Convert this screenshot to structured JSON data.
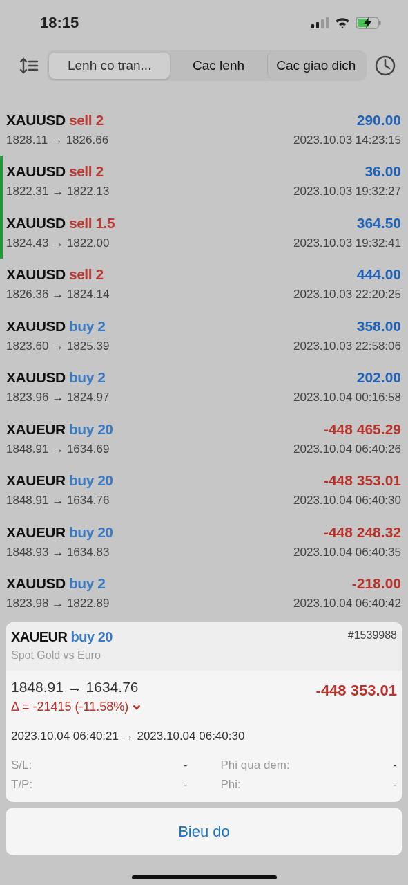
{
  "status_bar": {
    "time": "18:15"
  },
  "tabs": [
    {
      "label": "Lenh co tran...",
      "selected": true
    },
    {
      "label": "Cac lenh",
      "selected": false
    },
    {
      "label": "Cac giao dich",
      "selected": false
    }
  ],
  "trades": [
    {
      "symbol": "XAUUSD",
      "order": "sell 2",
      "kind": "sell",
      "prices": "1828.11 → 1826.66",
      "profit": "290.00",
      "loss": false,
      "time": "2023.10.03 14:23:15",
      "highlighted": false
    },
    {
      "symbol": "XAUUSD",
      "order": "sell 2",
      "kind": "sell",
      "prices": "1822.31 → 1822.13",
      "profit": "36.00",
      "loss": false,
      "time": "2023.10.03 19:32:27",
      "highlighted": true
    },
    {
      "symbol": "XAUUSD",
      "order": "sell 1.5",
      "kind": "sell",
      "prices": "1824.43 → 1822.00",
      "profit": "364.50",
      "loss": false,
      "time": "2023.10.03 19:32:41",
      "highlighted": true
    },
    {
      "symbol": "XAUUSD",
      "order": "sell 2",
      "kind": "sell",
      "prices": "1826.36 → 1824.14",
      "profit": "444.00",
      "loss": false,
      "time": "2023.10.03 22:20:25",
      "highlighted": false
    },
    {
      "symbol": "XAUUSD",
      "order": "buy 2",
      "kind": "buy",
      "prices": "1823.60 → 1825.39",
      "profit": "358.00",
      "loss": false,
      "time": "2023.10.03 22:58:06",
      "highlighted": false
    },
    {
      "symbol": "XAUUSD",
      "order": "buy 2",
      "kind": "buy",
      "prices": "1823.96 → 1824.97",
      "profit": "202.00",
      "loss": false,
      "time": "2023.10.04 00:16:58",
      "highlighted": false
    },
    {
      "symbol": "XAUEUR",
      "order": "buy 20",
      "kind": "buy",
      "prices": "1848.91 → 1634.69",
      "profit": "-448 465.29",
      "loss": true,
      "time": "2023.10.04 06:40:26",
      "highlighted": false
    },
    {
      "symbol": "XAUEUR",
      "order": "buy 20",
      "kind": "buy",
      "prices": "1848.91 → 1634.76",
      "profit": "-448 353.01",
      "loss": true,
      "time": "2023.10.04 06:40:30",
      "highlighted": false
    },
    {
      "symbol": "XAUEUR",
      "order": "buy 20",
      "kind": "buy",
      "prices": "1848.93 → 1634.83",
      "profit": "-448 248.32",
      "loss": true,
      "time": "2023.10.04 06:40:35",
      "highlighted": false
    },
    {
      "symbol": "XAUUSD",
      "order": "buy 2",
      "kind": "buy",
      "prices": "1823.98 → 1822.89",
      "profit": "-218.00",
      "loss": true,
      "time": "2023.10.04 06:40:42",
      "highlighted": false
    }
  ],
  "detail": {
    "symbol": "XAUEUR",
    "order": "buy 20",
    "kind": "buy",
    "ticket": "#1539988",
    "description": "Spot Gold vs Euro",
    "prices": "1848.91 → 1634.76",
    "profit": "-448 353.01",
    "loss": true,
    "delta": "Δ = -21415 (-11.58%)",
    "times": "2023.10.04 06:40:21 → 2023.10.04 06:40:30",
    "fields": [
      {
        "label": "S/L:",
        "value": "-"
      },
      {
        "label": "Phi qua dem:",
        "value": "-"
      },
      {
        "label": "T/P:",
        "value": "-"
      },
      {
        "label": "Phi:",
        "value": "-"
      }
    ]
  },
  "button": "Bieu do"
}
